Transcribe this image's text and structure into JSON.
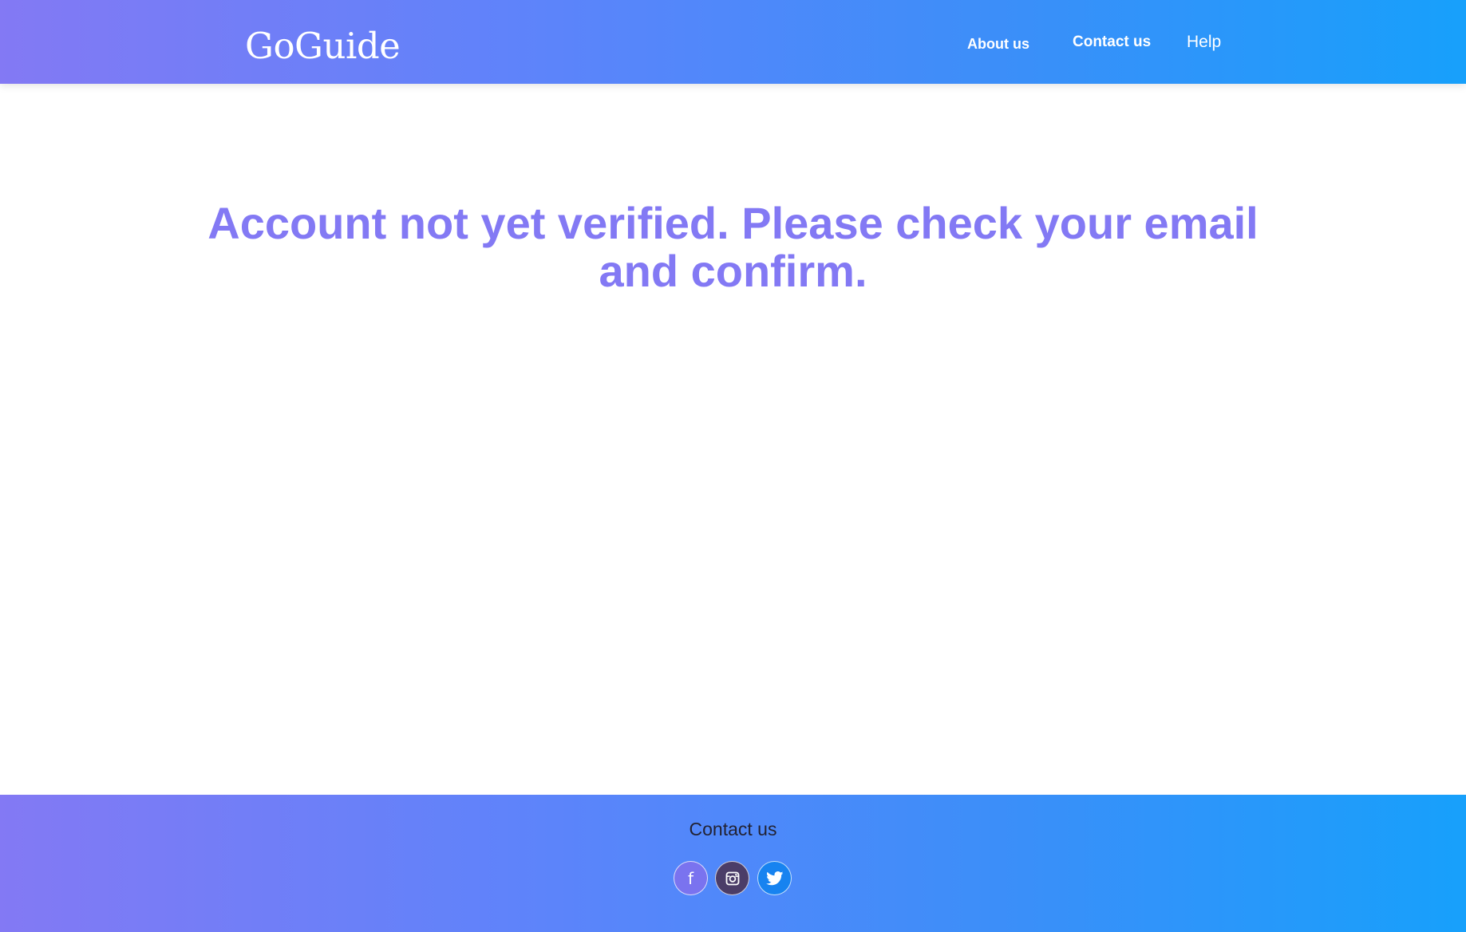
{
  "header": {
    "brand": "GoGuide",
    "nav": {
      "about": "About us",
      "contact": "Contact us",
      "help": "Help"
    }
  },
  "main": {
    "message": "Account not yet verified. Please check your email and confirm."
  },
  "footer": {
    "title": "Contact us",
    "social": [
      {
        "name": "facebook-icon",
        "glyph": "f"
      },
      {
        "name": "instagram-icon"
      },
      {
        "name": "twitter-icon"
      }
    ]
  },
  "colors": {
    "gradient_start": "#8379f4",
    "gradient_end": "#17a0fb",
    "message_text": "#8379f4"
  }
}
